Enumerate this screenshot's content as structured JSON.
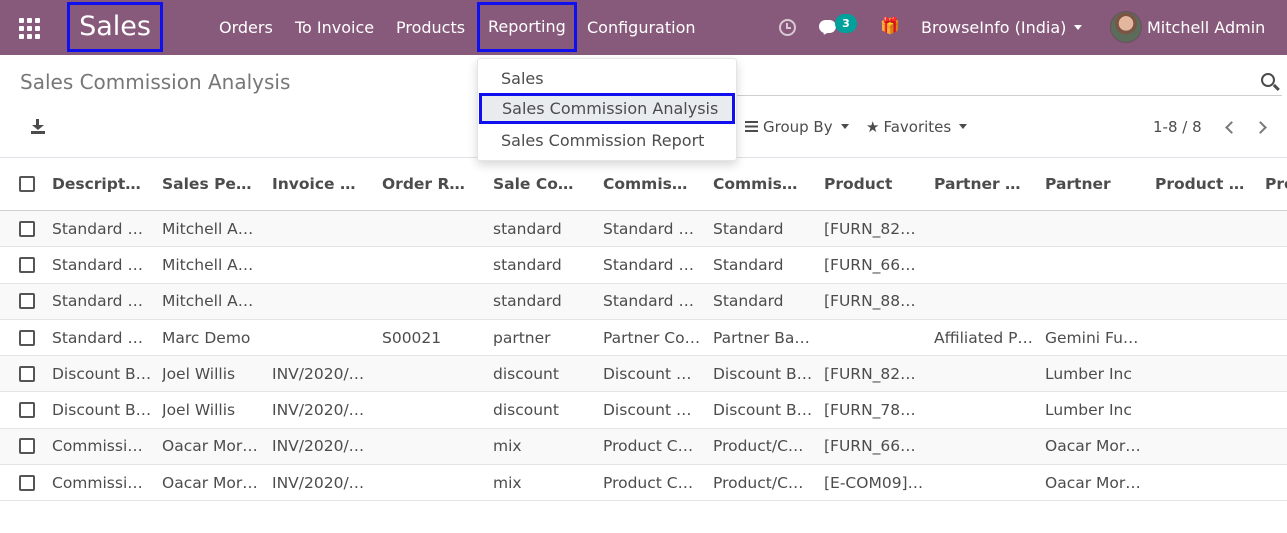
{
  "navbar": {
    "app_name": "Sales",
    "menu": [
      "Orders",
      "To Invoice",
      "Products",
      "Reporting",
      "Configuration"
    ],
    "active_menu": "Reporting",
    "messages_count": "3",
    "company": "BrowseInfo (India)",
    "user": "Mitchell Admin",
    "icons": [
      "apps-grid-icon",
      "clock-icon",
      "chat-icon",
      "gift-icon"
    ],
    "color": "#875a7b",
    "highlight_color": "#1010ee"
  },
  "control_panel": {
    "title": "Sales Commission Analysis",
    "group_by_label": "Group By",
    "favorites_label": "Favorites",
    "pager_value": "1-8 / 8"
  },
  "reporting_menu": {
    "items": [
      "Sales",
      "Sales Commission Analysis",
      "Sales Commission Report"
    ],
    "selected": "Sales Commission Analysis"
  },
  "table": {
    "columns": [
      "Descript…",
      "Sales Pe…",
      "Invoice …",
      "Order R…",
      "Sale Co…",
      "Commis…",
      "Commis…",
      "Product",
      "Partner …",
      "Partner",
      "Product …",
      "Pro"
    ],
    "rows": [
      [
        "Standard …",
        "Mitchell A…",
        "",
        "",
        "standard",
        "Standard …",
        "Standard",
        "[FURN_82…",
        "",
        "",
        ""
      ],
      [
        "Standard …",
        "Mitchell A…",
        "",
        "",
        "standard",
        "Standard …",
        "Standard",
        "[FURN_66…",
        "",
        "",
        ""
      ],
      [
        "Standard …",
        "Mitchell A…",
        "",
        "",
        "standard",
        "Standard …",
        "Standard",
        "[FURN_88…",
        "",
        "",
        ""
      ],
      [
        "Standard …",
        "Marc Demo",
        "",
        "S00021",
        "partner",
        "Partner Co…",
        "Partner Ba…",
        "",
        "Affiliated P…",
        "Gemini Fu…",
        ""
      ],
      [
        "Discount B…",
        "Joel Willis",
        "INV/2020/…",
        "",
        "discount",
        "Discount …",
        "Discount B…",
        "[FURN_82…",
        "",
        "Lumber Inc",
        ""
      ],
      [
        "Discount B…",
        "Joel Willis",
        "INV/2020/…",
        "",
        "discount",
        "Discount …",
        "Discount B…",
        "[FURN_78…",
        "",
        "Lumber Inc",
        ""
      ],
      [
        "Commissi…",
        "Oacar Mor…",
        "INV/2020/…",
        "",
        "mix",
        "Product C…",
        "Product/C…",
        "[FURN_66…",
        "",
        "Oacar Mor…",
        ""
      ],
      [
        "Commissi…",
        "Oacar Mor…",
        "INV/2020/…",
        "",
        "mix",
        "Product C…",
        "Product/C…",
        "[E-COM09]…",
        "",
        "Oacar Mor…",
        ""
      ]
    ]
  }
}
